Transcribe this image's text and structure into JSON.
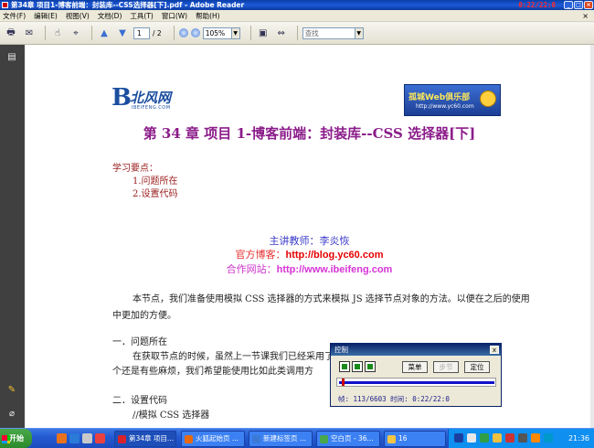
{
  "window": {
    "title": "第34章  项目1-博客前端：封装库--CSS选择器[下].pdf - Adobe Reader",
    "clock": "0:22/22:0"
  },
  "menu": [
    "文件(F)",
    "编辑(E)",
    "视图(V)",
    "文档(D)",
    "工具(T)",
    "窗口(W)",
    "帮助(H)"
  ],
  "toolbar": {
    "page_current": "1",
    "page_total": "/ 2",
    "zoom": "105%",
    "search_placeholder": "查找"
  },
  "document": {
    "logo_left_text": "北风网",
    "logo_left_sub": "IBEIFENG.COM",
    "logo_right_title": "孤城Web俱乐部",
    "logo_right_url": "http://www.yc60.com",
    "heading": "第 34 章  项目 1-博客前端：封装库--CSS 选择器[下]",
    "points_title": "学习要点：",
    "points": [
      "1.问题所在",
      "2.设置代码"
    ],
    "teacher_label": "主讲教师：李炎恢",
    "blog_label": "官方博客：",
    "blog_url": "http://blog.yc60.com",
    "partner_label": "合作网站：",
    "partner_url": "http://www.ibeifeng.com",
    "intro": "本节点，我们准备使用模拟 CSS 选择器的方式来模拟 JS 选择节点对象的方法。以便在之后的使用中更加的方便。",
    "section1_title": "一．问题所在",
    "section1_text": "在获取节点的时候，虽然上一节课我们已经采用了",
    "section1_text2": "个还是有些麻烦，我们希望能使用比如此类调用方",
    "section2_title": "二．设置代码",
    "section2_text": "//模拟 CSS 选择器"
  },
  "control_dialog": {
    "title": "控制",
    "close": "x",
    "buttons": [
      "菜单",
      "步节",
      "定位"
    ],
    "status": "帧: 113/6603  时间: 0:22/22:0",
    "progress": 0.017
  },
  "taskbar": {
    "start": "开始",
    "tasks": [
      {
        "label": "第34章 项目...",
        "color": "#d8232a"
      },
      {
        "label": "火狐起始页 ...",
        "color": "#e86a10"
      },
      {
        "label": "新建标签页 ...",
        "color": "#3a7ad6"
      },
      {
        "label": "空白页 - 36...",
        "color": "#49a84a"
      },
      {
        "label": "16",
        "color": "#f5c542"
      }
    ],
    "time": "21:36"
  }
}
